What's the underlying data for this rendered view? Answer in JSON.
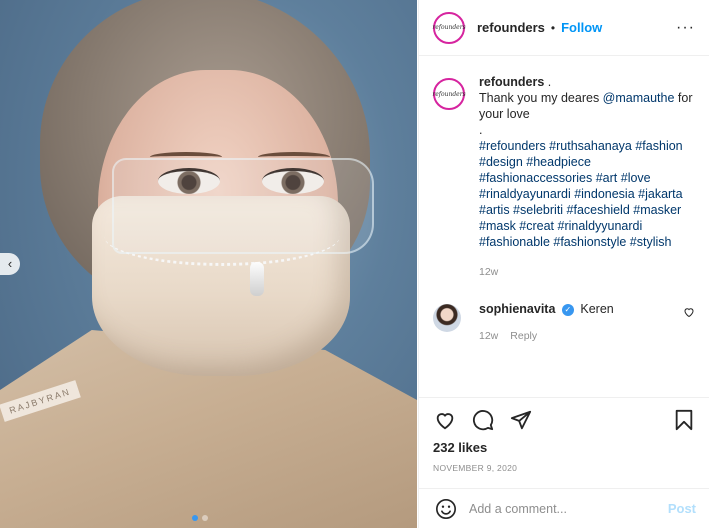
{
  "post": {
    "username": "refounders",
    "follow_label": "Follow",
    "separator": "•",
    "more_label": "···",
    "avatar_text": "refounders"
  },
  "photo": {
    "jacket_text": "RAJBYRAN"
  },
  "caption": {
    "username": "refounders",
    "suffix": " .",
    "text_before_mention": "Thank you my deares ",
    "mention": "@mamauthe",
    "text_after_mention": " for your love",
    "dot_line": ".",
    "hashtags": "#refounders #ruthsahanaya #fashion #design #headpiece #fashionaccessories #art #love #rinaldyayunardi #indonesia #jakarta #artis #selebriti #faceshield #masker #mask #creat #rinaldyyunardi #fashionable #fashionstyle #stylish",
    "time": "12w"
  },
  "comment": {
    "username": "sophienavita",
    "verified_glyph": "✓",
    "text": "Keren",
    "time": "12w",
    "reply_label": "Reply"
  },
  "stats": {
    "likes": "232 likes",
    "date": "NOVEMBER 9, 2020"
  },
  "composer": {
    "placeholder": "Add a comment...",
    "post_label": "Post"
  },
  "carousel": {
    "prev_glyph": "‹",
    "dot_count": 2,
    "active_index": 0
  }
}
